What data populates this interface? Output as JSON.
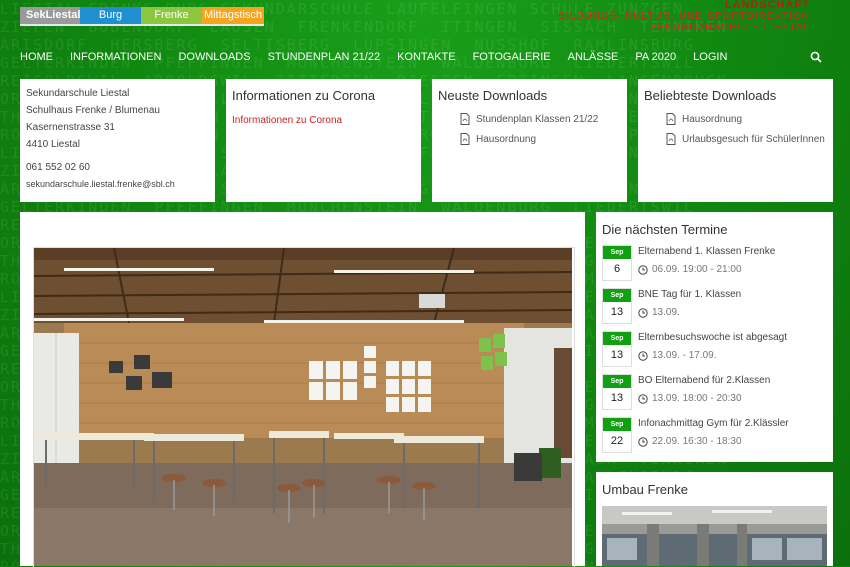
{
  "background_text": [
    "LIESTAL FRENKE BURG SEKUNDARSCHULE LAUFELFINGEN SCHULE ZUNZGEN",
    "ZIEFEN  BUBENDORF  LAUSEN  FRENKENDORF  ITINGEN  SISSACH  TENNIKEN",
    "ARISDORF  HERSBERG  SELTISBERG  LUPSINGEN  NUSSHOF  RAMLINSBURG",
    "GELTERKINDEN  PFEFFINGEN  MUNCHENSTEIN  WALDENBURG  LIEDERTSWIL",
    "REIGOLDSWIL  ARBOLDSWIL  TITTERTEN  DIEGTEN  EPTINGEN  LANGENBRUCK",
    "ORMALINGEN  ALLSCHWIL  GIEBENACH  ANWIL  PRATTELN  GRELLINGEN",
    "THURNEN  DIEPFLINGEN  WENSLINGEN  HOLSTEIN  LAMPENBERG  BENNWIL",
    "ROTHENFLUH  OLTINGEN  BUCKTEN  RUNENBERG  KILCHBERG  MAISPRACH",
    "LIESTAL FRENKE BURG SEKUNDARSCHULE LAUFELFINGEN SCHULE ZUNZGEN",
    "ZIEFEN  BUBENDORF  LAUSEN  FRENKENDORF  ITINGEN  SISSACH  TENNIKEN",
    "ARISDORF  HERSBERG  SELTISBERG  LUPSINGEN  NUSSHOF  RAMLINSBURG",
    "GELTERKINDEN  PFEFFINGEN  MUNCHENSTEIN  WALDENBURG  LIEDERTSWIL",
    "REIGOLDSWIL  ARBOLDSWIL  TITTERTEN  DIEGTEN  EPTINGEN  LANGENBRUCK",
    "ORMALINGEN  ALLSCHWIL  GIEBENACH  ANWIL  PRATTELN  GRELLINGEN",
    "THURNEN  DIEPFLINGEN  WENSLINGEN  HOLSTEIN  LAMPENBERG  BENNWIL",
    "ROTHENFLUH  OLTINGEN  BUCKTEN  RUNENBERG  KILCHBERG  MAISPRACH",
    "LIESTAL FRENKE BURG SEKUNDARSCHULE LAUFELFINGEN SCHULE ZUNZGEN",
    "ZIEFEN  BUBENDORF  LAUSEN  FRENKENDORF  ITINGEN  SISSACH  TENNIKEN",
    "ARISDORF  HERSBERG  SELTISBERG  LUPSINGEN  NUSSHOF  RAMLINSBURG",
    "GELTERKINDEN  PFEFFINGEN  MUNCHENSTEIN  WALDENBURG  LIEDERTSWIL",
    "REIGOLDSWIL  ARBOLDSWIL  TITTERTEN  DIEGTEN  EPTINGEN  LANGENBRUCK",
    "ORMALINGEN  ALLSCHWIL  GIEBENACH  ANWIL  PRATTELN  GRELLINGEN",
    "THURNEN  DIEPFLINGEN  WENSLINGEN  HOLSTEIN  LAMPENBERG  BENNWIL",
    "ROTHENFLUH  OLTINGEN  BUCKTEN  RUNENBERG  KILCHBERG  MAISPRACH",
    "LIESTAL FRENKE BURG SEKUNDARSCHULE LAUFELFINGEN SCHULE ZUNZGEN",
    "ZIEFEN  BUBENDORF  LAUSEN  FRENKENDORF  ITINGEN  SISSACH  TENNIKEN",
    "ARISDORF  HERSBERG  SELTISBERG  LUPSINGEN  NUSSHOF  RAMLINSBURG",
    "GELTERKINDEN  PFEFFINGEN  MUNCHENSTEIN  WALDENBURG  LIEDERTSWIL",
    "REIGOLDSWIL  ARBOLDSWIL  TITTERTEN  DIEGTEN  EPTINGEN  LANGENBRUCK",
    "ORMALINGEN  ALLSCHWIL  GIEBENACH  ANWIL  PRATTELN  GRELLINGEN",
    "THURNEN  DIEPFLINGEN  WENSLINGEN  HOLSTEIN  LAMPENBERG  BENNWIL",
    "ROTHENFLUH  OLTINGEN  BUCKTEN  RUNENBERG  KILCHBERG  MAISPRACH"
  ],
  "school_tabs": [
    {
      "label": "SekLiestal",
      "color": "#9a9a9a"
    },
    {
      "label": "Burg",
      "color": "#1f8fd2"
    },
    {
      "label": "Frenke",
      "color": "#8cc63f"
    },
    {
      "label": "Mittagstisch",
      "color": "#f7a41d"
    }
  ],
  "tagline": {
    "line1": "LANDSCHAFT",
    "line2": "BILDUNGS- KULTUR- UND SPORTDIREKTION",
    "line3": "SEKUNDARSCHULE LIESTAL"
  },
  "nav": {
    "items": [
      "HOME",
      "INFORMATIONEN",
      "DOWNLOADS",
      "STUNDENPLAN 21/22",
      "KONTAKTE",
      "FOTOGALERIE",
      "ANLÄSSE",
      "PA 2020",
      "LOGIN"
    ],
    "search_icon": "search-icon"
  },
  "address_card": {
    "line1": "Sekundarschule Liestal",
    "line2": "Schulhaus Frenke / Blumenau",
    "line3": "Kasernenstrasse 31",
    "line4": "4410 Liestal",
    "phone": "061 552 02 60",
    "email": "sekundarschule.liestal.frenke@sbl.ch"
  },
  "corona_card": {
    "title": "Informationen zu Corona",
    "link": "Informationen zu Corona"
  },
  "downloads_card": {
    "title": "Neuste Downloads",
    "items": [
      "Stundenplan Klassen 21/22",
      "Hausordnung"
    ]
  },
  "popular_card": {
    "title": "Beliebteste Downloads",
    "items": [
      "Hausordnung",
      "Urlaubsgesuch für SchülerInnen"
    ]
  },
  "termine": {
    "title": "Die nächsten Termine",
    "items": [
      {
        "month": "Sep",
        "day": "6",
        "title": "Elternabend 1. Klassen Frenke",
        "when": "06.09. 19:00 - 21:00"
      },
      {
        "month": "Sep",
        "day": "13",
        "title": "BNE Tag für 1. Klassen",
        "when": "13.09."
      },
      {
        "month": "Sep",
        "day": "13",
        "title": "Elternbesuchswoche ist abgesagt",
        "when": "13.09. - 17.09."
      },
      {
        "month": "Sep",
        "day": "13",
        "title": "BO Elternabend für 2.Klassen",
        "when": "13.09. 18:00 - 20:30"
      },
      {
        "month": "Sep",
        "day": "22",
        "title": "Infonachmittag Gym für 2.Klässler",
        "when": "22.09. 16:30 - 18:30"
      }
    ]
  },
  "umbau": {
    "title": "Umbau Frenke"
  },
  "colors": {
    "brand_green": "#11a011",
    "link_red": "#d02020"
  }
}
